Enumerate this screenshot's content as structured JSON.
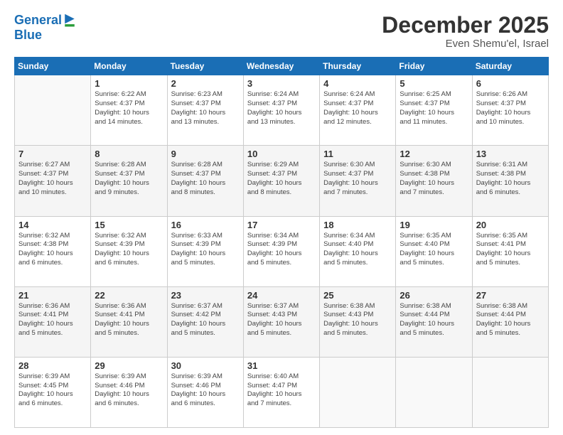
{
  "logo": {
    "line1": "General",
    "line2": "Blue"
  },
  "title": "December 2025",
  "subtitle": "Even Shemu'el, Israel",
  "days_header": [
    "Sunday",
    "Monday",
    "Tuesday",
    "Wednesday",
    "Thursday",
    "Friday",
    "Saturday"
  ],
  "weeks": [
    [
      {
        "num": "",
        "info": ""
      },
      {
        "num": "1",
        "info": "Sunrise: 6:22 AM\nSunset: 4:37 PM\nDaylight: 10 hours\nand 14 minutes."
      },
      {
        "num": "2",
        "info": "Sunrise: 6:23 AM\nSunset: 4:37 PM\nDaylight: 10 hours\nand 13 minutes."
      },
      {
        "num": "3",
        "info": "Sunrise: 6:24 AM\nSunset: 4:37 PM\nDaylight: 10 hours\nand 13 minutes."
      },
      {
        "num": "4",
        "info": "Sunrise: 6:24 AM\nSunset: 4:37 PM\nDaylight: 10 hours\nand 12 minutes."
      },
      {
        "num": "5",
        "info": "Sunrise: 6:25 AM\nSunset: 4:37 PM\nDaylight: 10 hours\nand 11 minutes."
      },
      {
        "num": "6",
        "info": "Sunrise: 6:26 AM\nSunset: 4:37 PM\nDaylight: 10 hours\nand 10 minutes."
      }
    ],
    [
      {
        "num": "7",
        "info": "Sunrise: 6:27 AM\nSunset: 4:37 PM\nDaylight: 10 hours\nand 10 minutes."
      },
      {
        "num": "8",
        "info": "Sunrise: 6:28 AM\nSunset: 4:37 PM\nDaylight: 10 hours\nand 9 minutes."
      },
      {
        "num": "9",
        "info": "Sunrise: 6:28 AM\nSunset: 4:37 PM\nDaylight: 10 hours\nand 8 minutes."
      },
      {
        "num": "10",
        "info": "Sunrise: 6:29 AM\nSunset: 4:37 PM\nDaylight: 10 hours\nand 8 minutes."
      },
      {
        "num": "11",
        "info": "Sunrise: 6:30 AM\nSunset: 4:37 PM\nDaylight: 10 hours\nand 7 minutes."
      },
      {
        "num": "12",
        "info": "Sunrise: 6:30 AM\nSunset: 4:38 PM\nDaylight: 10 hours\nand 7 minutes."
      },
      {
        "num": "13",
        "info": "Sunrise: 6:31 AM\nSunset: 4:38 PM\nDaylight: 10 hours\nand 6 minutes."
      }
    ],
    [
      {
        "num": "14",
        "info": "Sunrise: 6:32 AM\nSunset: 4:38 PM\nDaylight: 10 hours\nand 6 minutes."
      },
      {
        "num": "15",
        "info": "Sunrise: 6:32 AM\nSunset: 4:39 PM\nDaylight: 10 hours\nand 6 minutes."
      },
      {
        "num": "16",
        "info": "Sunrise: 6:33 AM\nSunset: 4:39 PM\nDaylight: 10 hours\nand 5 minutes."
      },
      {
        "num": "17",
        "info": "Sunrise: 6:34 AM\nSunset: 4:39 PM\nDaylight: 10 hours\nand 5 minutes."
      },
      {
        "num": "18",
        "info": "Sunrise: 6:34 AM\nSunset: 4:40 PM\nDaylight: 10 hours\nand 5 minutes."
      },
      {
        "num": "19",
        "info": "Sunrise: 6:35 AM\nSunset: 4:40 PM\nDaylight: 10 hours\nand 5 minutes."
      },
      {
        "num": "20",
        "info": "Sunrise: 6:35 AM\nSunset: 4:41 PM\nDaylight: 10 hours\nand 5 minutes."
      }
    ],
    [
      {
        "num": "21",
        "info": "Sunrise: 6:36 AM\nSunset: 4:41 PM\nDaylight: 10 hours\nand 5 minutes."
      },
      {
        "num": "22",
        "info": "Sunrise: 6:36 AM\nSunset: 4:41 PM\nDaylight: 10 hours\nand 5 minutes."
      },
      {
        "num": "23",
        "info": "Sunrise: 6:37 AM\nSunset: 4:42 PM\nDaylight: 10 hours\nand 5 minutes."
      },
      {
        "num": "24",
        "info": "Sunrise: 6:37 AM\nSunset: 4:43 PM\nDaylight: 10 hours\nand 5 minutes."
      },
      {
        "num": "25",
        "info": "Sunrise: 6:38 AM\nSunset: 4:43 PM\nDaylight: 10 hours\nand 5 minutes."
      },
      {
        "num": "26",
        "info": "Sunrise: 6:38 AM\nSunset: 4:44 PM\nDaylight: 10 hours\nand 5 minutes."
      },
      {
        "num": "27",
        "info": "Sunrise: 6:38 AM\nSunset: 4:44 PM\nDaylight: 10 hours\nand 5 minutes."
      }
    ],
    [
      {
        "num": "28",
        "info": "Sunrise: 6:39 AM\nSunset: 4:45 PM\nDaylight: 10 hours\nand 6 minutes."
      },
      {
        "num": "29",
        "info": "Sunrise: 6:39 AM\nSunset: 4:46 PM\nDaylight: 10 hours\nand 6 minutes."
      },
      {
        "num": "30",
        "info": "Sunrise: 6:39 AM\nSunset: 4:46 PM\nDaylight: 10 hours\nand 6 minutes."
      },
      {
        "num": "31",
        "info": "Sunrise: 6:40 AM\nSunset: 4:47 PM\nDaylight: 10 hours\nand 7 minutes."
      },
      {
        "num": "",
        "info": ""
      },
      {
        "num": "",
        "info": ""
      },
      {
        "num": "",
        "info": ""
      }
    ]
  ]
}
